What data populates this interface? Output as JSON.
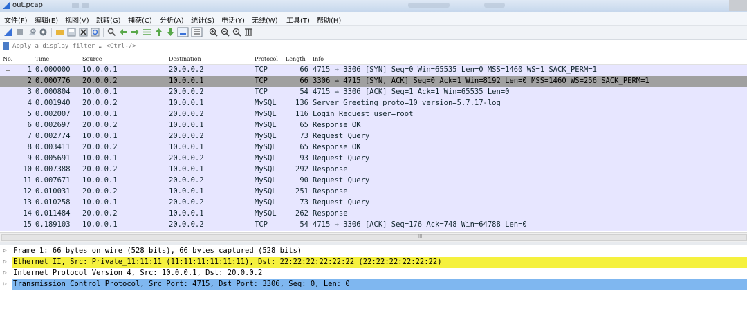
{
  "window": {
    "title": "out.pcap"
  },
  "menu": [
    "文件(F)",
    "编辑(E)",
    "视图(V)",
    "跳转(G)",
    "捕获(C)",
    "分析(A)",
    "统计(S)",
    "电话(Y)",
    "无线(W)",
    "工具(T)",
    "帮助(H)"
  ],
  "toolbar": {
    "icons": [
      "shark-fin-icon",
      "stop-icon",
      "restart-icon",
      "options-icon",
      "open-icon",
      "save-icon",
      "close-file-icon",
      "reload-icon",
      "find-icon",
      "back-icon",
      "forward-icon",
      "goto-icon",
      "first-icon",
      "last-icon",
      "autoscroll-icon",
      "colorize-icon",
      "zoom-in-icon",
      "zoom-out-icon",
      "zoom-normal-icon",
      "resize-columns-icon"
    ]
  },
  "filter": {
    "placeholder": "Apply a display filter … <Ctrl-/>"
  },
  "columns": [
    "No.",
    "Time",
    "Source",
    "Destination",
    "Protocol",
    "Length",
    "Info"
  ],
  "packets": [
    {
      "no": "1",
      "time": "0.000000",
      "src": "10.0.0.1",
      "dst": "20.0.0.2",
      "proto": "TCP",
      "len": "66",
      "info": "4715 → 3306 [SYN] Seq=0 Win=65535 Len=0 MSS=1460 WS=1 SACK_PERM=1"
    },
    {
      "no": "2",
      "time": "0.000776",
      "src": "20.0.0.2",
      "dst": "10.0.0.1",
      "proto": "TCP",
      "len": "66",
      "info": "3306 → 4715 [SYN, ACK] Seq=0 Ack=1 Win=8192 Len=0 MSS=1460 WS=256 SACK_PERM=1"
    },
    {
      "no": "3",
      "time": "0.000804",
      "src": "10.0.0.1",
      "dst": "20.0.0.2",
      "proto": "TCP",
      "len": "54",
      "info": "4715 → 3306 [ACK] Seq=1 Ack=1 Win=65535 Len=0"
    },
    {
      "no": "4",
      "time": "0.001940",
      "src": "20.0.0.2",
      "dst": "10.0.0.1",
      "proto": "MySQL",
      "len": "136",
      "info": "Server Greeting proto=10 version=5.7.17-log"
    },
    {
      "no": "5",
      "time": "0.002007",
      "src": "10.0.0.1",
      "dst": "20.0.0.2",
      "proto": "MySQL",
      "len": "116",
      "info": "Login Request user=root"
    },
    {
      "no": "6",
      "time": "0.002697",
      "src": "20.0.0.2",
      "dst": "10.0.0.1",
      "proto": "MySQL",
      "len": "65",
      "info": "Response OK"
    },
    {
      "no": "7",
      "time": "0.002774",
      "src": "10.0.0.1",
      "dst": "20.0.0.2",
      "proto": "MySQL",
      "len": "73",
      "info": "Request Query"
    },
    {
      "no": "8",
      "time": "0.003411",
      "src": "20.0.0.2",
      "dst": "10.0.0.1",
      "proto": "MySQL",
      "len": "65",
      "info": "Response OK"
    },
    {
      "no": "9",
      "time": "0.005691",
      "src": "10.0.0.1",
      "dst": "20.0.0.2",
      "proto": "MySQL",
      "len": "93",
      "info": "Request Query"
    },
    {
      "no": "10",
      "time": "0.007388",
      "src": "20.0.0.2",
      "dst": "10.0.0.1",
      "proto": "MySQL",
      "len": "292",
      "info": "Response"
    },
    {
      "no": "11",
      "time": "0.007671",
      "src": "10.0.0.1",
      "dst": "20.0.0.2",
      "proto": "MySQL",
      "len": "90",
      "info": "Request Query"
    },
    {
      "no": "12",
      "time": "0.010031",
      "src": "20.0.0.2",
      "dst": "10.0.0.1",
      "proto": "MySQL",
      "len": "251",
      "info": "Response"
    },
    {
      "no": "13",
      "time": "0.010258",
      "src": "10.0.0.1",
      "dst": "20.0.0.2",
      "proto": "MySQL",
      "len": "73",
      "info": "Request Query"
    },
    {
      "no": "14",
      "time": "0.011484",
      "src": "20.0.0.2",
      "dst": "10.0.0.1",
      "proto": "MySQL",
      "len": "262",
      "info": "Response"
    },
    {
      "no": "15",
      "time": "0.189103",
      "src": "10.0.0.1",
      "dst": "20.0.0.2",
      "proto": "TCP",
      "len": "54",
      "info": "4715 → 3306 [ACK] Seq=176 Ack=748 Win=64788 Len=0"
    }
  ],
  "selected_packet": "2",
  "hscroll_grip": "III",
  "details": [
    {
      "text": "Frame 1: 66 bytes on wire (528 bits), 66 bytes captured (528 bits)",
      "highlight": ""
    },
    {
      "text": "Ethernet II, Src: Private_11:11:11 (11:11:11:11:11:11), Dst: 22:22:22:22:22:22 (22:22:22:22:22:22)",
      "highlight": "#f5f13e"
    },
    {
      "text": "Internet Protocol Version 4, Src: 10.0.0.1, Dst: 20.0.0.2",
      "highlight": ""
    },
    {
      "text": "Transmission Control Protocol, Src Port: 4715, Dst Port: 3306, Seq: 0, Len: 0",
      "highlight": "#7fb7f0"
    }
  ],
  "colors": {
    "row_bg": "#e7e6ff",
    "selected_bg": "#a0a0a0",
    "eth_highlight": "#f5f13e",
    "tcp_highlight": "#7fb7f0"
  }
}
